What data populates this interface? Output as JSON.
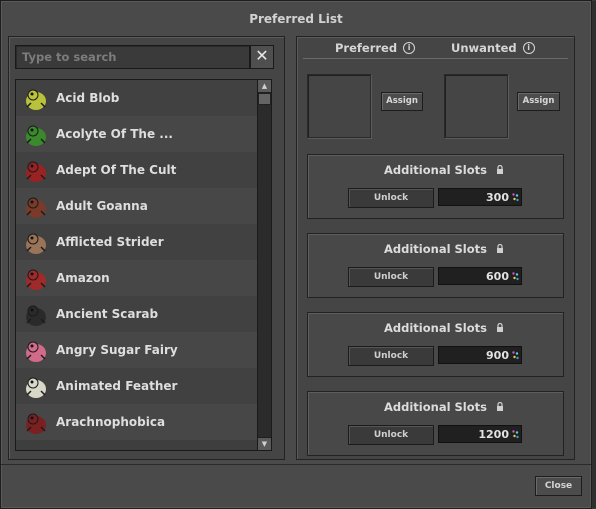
{
  "window": {
    "title": "Preferred List"
  },
  "search": {
    "placeholder": "Type to search",
    "clear_label": "✕"
  },
  "list": {
    "items": [
      {
        "label": "Acid Blob",
        "icon": "acid-blob-icon",
        "color": "#b9c23a"
      },
      {
        "label": "Acolyte Of The ...",
        "icon": "acolyte-icon",
        "color": "#3a8a2c"
      },
      {
        "label": "Adept Of The Cult",
        "icon": "adept-icon",
        "color": "#9a2222"
      },
      {
        "label": "Adult Goanna",
        "icon": "goanna-icon",
        "color": "#7a3a2a"
      },
      {
        "label": "Afflicted Strider",
        "icon": "strider-icon",
        "color": "#9a7458"
      },
      {
        "label": "Amazon",
        "icon": "amazon-icon",
        "color": "#a02a2a"
      },
      {
        "label": "Ancient Scarab",
        "icon": "scarab-icon",
        "color": "#2a2a2a"
      },
      {
        "label": "Angry Sugar Fairy",
        "icon": "fairy-icon",
        "color": "#d26a8a"
      },
      {
        "label": "Animated Feather",
        "icon": "feather-icon",
        "color": "#d8d8c8"
      },
      {
        "label": "Arachnophobica",
        "icon": "arachno-icon",
        "color": "#7a2020"
      }
    ]
  },
  "right": {
    "preferred_label": "Preferred",
    "unwanted_label": "Unwanted",
    "assign_label": "Assign",
    "slots": [
      {
        "title": "Additional Slots",
        "unlock_label": "Unlock",
        "price": "300"
      },
      {
        "title": "Additional Slots",
        "unlock_label": "Unlock",
        "price": "600"
      },
      {
        "title": "Additional Slots",
        "unlock_label": "Unlock",
        "price": "900"
      },
      {
        "title": "Additional Slots",
        "unlock_label": "Unlock",
        "price": "1200"
      }
    ]
  },
  "footer": {
    "close_label": "Close"
  }
}
